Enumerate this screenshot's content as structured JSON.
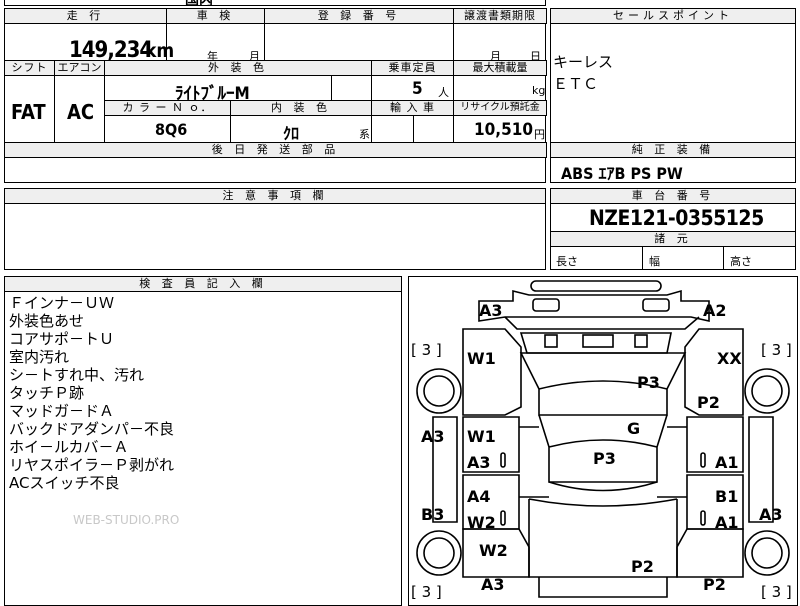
{
  "top_cut": {
    "text": "国内"
  },
  "mileage": {
    "label": "走 行",
    "value": "149,234",
    "unit": "km"
  },
  "inspection": {
    "label": "車 検",
    "year_unit": "年",
    "month_unit": "月"
  },
  "registration": {
    "label": "登 録 番 号"
  },
  "transfer": {
    "label": "譲渡書類期限",
    "month_unit": "月",
    "day_unit": "日"
  },
  "sales_point": {
    "label": "セールスポイント",
    "items": [
      "キーレス",
      "ＥＴＣ"
    ]
  },
  "shift": {
    "label": "シフト",
    "value": "FAT"
  },
  "aircon": {
    "label": "エアコン",
    "value": "AC"
  },
  "exterior": {
    "label": "外 装 色",
    "value": "ﾗｲﾄﾌﾞﾙｰM"
  },
  "capacity": {
    "label": "乗車定員",
    "value": "5",
    "unit": "人"
  },
  "max_load": {
    "label": "最大積載量",
    "unit": "kg"
  },
  "color_no": {
    "label": "カ ラ ー Ｎ ｏ．",
    "value": "8Q6"
  },
  "interior": {
    "label": "内 装 色",
    "value": "ｸﾛ",
    "suffix": "系"
  },
  "import": {
    "label": "輸 入 車"
  },
  "recycle": {
    "label": "リサイクル預託金",
    "value": "10,510",
    "unit": "円"
  },
  "later_parts": {
    "label": "後 日 発 送 部 品"
  },
  "standard_equip": {
    "label": "純 正 装 備",
    "value": "ABS ｴｱB PS PW"
  },
  "caution": {
    "label": "注 意 事 項 欄"
  },
  "chassis": {
    "label": "車 台 番 号",
    "value": "NZE121-0355125"
  },
  "dimensions": {
    "label": "諸 元",
    "length": "長さ",
    "width": "幅",
    "height": "高さ"
  },
  "inspector": {
    "label": "検 査 員 記 入 欄",
    "notes": [
      "Ｆインナ－ＵＷ",
      "外装色あせ",
      "コアサポ－トＵ",
      "室内汚れ",
      "シ－トすれ中、汚れ",
      "タッチＰ跡",
      "マッドガ－ドＡ",
      "バックドアダンパ－不良",
      "ホイ－ルカバ－Ａ",
      "リヤスポイラ－Ｐ剥がれ",
      "ACスイッチ不良"
    ],
    "watermark": "WEB-STUDIO.PRO"
  },
  "diagram": {
    "marks": [
      "A3",
      "A2",
      "W1",
      "XX",
      "P3",
      "P2",
      "A3",
      "W1",
      "G",
      "A3",
      "P3",
      "A1",
      "A4",
      "B1",
      "B3",
      "W2",
      "A1",
      "A3",
      "W2",
      "P2",
      "A3",
      "P2"
    ],
    "tires": [
      "[ 3 ]",
      "[ 3 ]",
      "[ 3 ]",
      "[ 3 ]"
    ]
  }
}
